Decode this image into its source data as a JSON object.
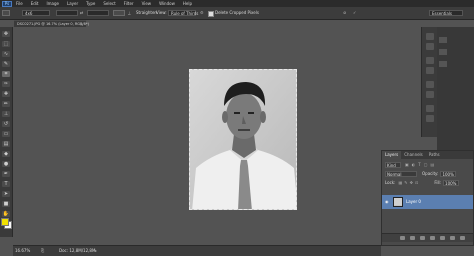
{
  "menubar": {
    "logo": "Ps",
    "items": [
      "File",
      "Edit",
      "Image",
      "Layer",
      "Type",
      "Select",
      "Filter",
      "View",
      "Window",
      "Help"
    ]
  },
  "options": {
    "ratio_value": "4x6",
    "straighten_label": "Straighten",
    "view_label": "View:",
    "view_value": "Rule of Thirds",
    "delete_cropped_label": "Delete Cropped Pixels",
    "workspace_value": "Essentials"
  },
  "document": {
    "tab_title": "DSC0271.JPG @ 16.7% (Layer 0, RGB/8*)",
    "zoom": "16.67%",
    "doc_size": "Doc: 12,8M/12,8M"
  },
  "layers_panel": {
    "tabs": [
      "Layers",
      "Channels",
      "Paths"
    ],
    "kind_label": "Kind",
    "blend_mode": "Normal",
    "opacity_label": "Opacity:",
    "opacity_value": "100%",
    "lock_label": "Lock:",
    "fill_label": "Fill:",
    "fill_value": "100%",
    "layer_name": "Layer 0"
  },
  "colors": {
    "foreground": "#f1e100",
    "background": "#f8f8f8",
    "selected_layer": "#5b7fb1"
  }
}
